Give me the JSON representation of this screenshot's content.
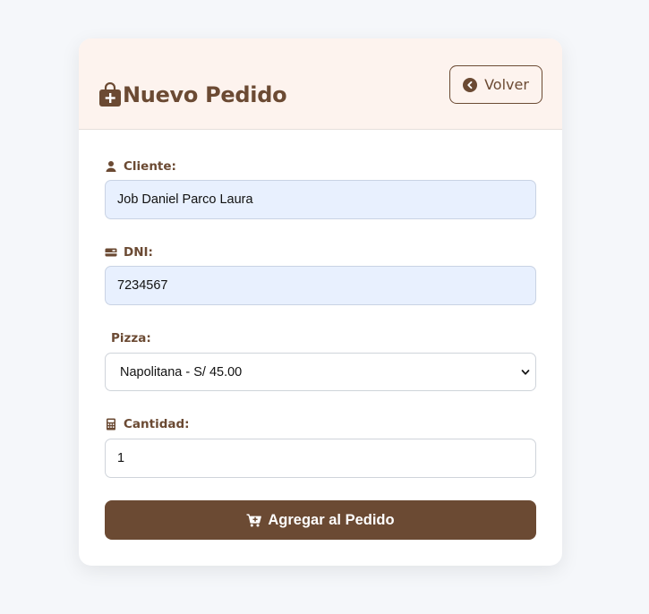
{
  "header": {
    "title": "Nuevo Pedido",
    "back_label": "Volver"
  },
  "form": {
    "cliente": {
      "label": "Cliente:",
      "value": "Job Daniel Parco Laura",
      "icon": "user-icon"
    },
    "dni": {
      "label": "DNI:",
      "value": "7234567",
      "icon": "id-card-icon"
    },
    "pizza": {
      "label": "Pizza:",
      "selected": "Napolitana - S/ 45.00"
    },
    "cantidad": {
      "label": "Cantidad:",
      "value": "1",
      "icon": "calculator-icon"
    },
    "submit_label": "Agregar al Pedido"
  },
  "colors": {
    "brand": "#6b4a33",
    "header_bg": "#fdf3ee",
    "autofill_bg": "#e8f0fe",
    "page_bg": "#f5f7fa"
  }
}
